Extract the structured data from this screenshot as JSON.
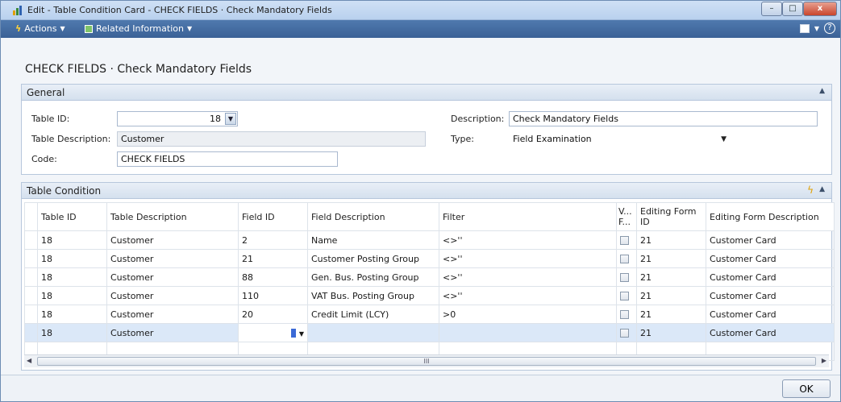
{
  "window": {
    "title": "Edit - Table Condition Card - CHECK FIELDS · Check Mandatory Fields",
    "min": "–",
    "max": "□",
    "close": "x"
  },
  "toolbar": {
    "actions_label": "Actions",
    "related_label": "Related Information",
    "caret": "▼",
    "help_icon": "?"
  },
  "page_title": "CHECK FIELDS · Check Mandatory Fields",
  "general": {
    "header": "General",
    "table_id_label": "Table ID:",
    "table_id_value": "18",
    "table_desc_label": "Table Description:",
    "table_desc_value": "Customer",
    "code_label": "Code:",
    "code_value": "CHECK FIELDS",
    "description_label": "Description:",
    "description_value": "Check Mandatory Fields",
    "type_label": "Type:",
    "type_value": "Field Examination"
  },
  "condition": {
    "header": "Table Condition",
    "columns": {
      "table_id": "Table ID",
      "table_desc": "Table Description",
      "field_id": "Field ID",
      "field_desc": "Field Description",
      "filter": "Filter",
      "vf_1": "V...",
      "vf_2": "F...",
      "edit_form_1": "Editing Form",
      "edit_form_2": "ID",
      "edit_form_desc": "Editing Form Description"
    },
    "rows": [
      {
        "table_id": "18",
        "table_desc": "Customer",
        "field_id": "2",
        "field_desc": "Name",
        "filter": "<>''",
        "form_id": "21",
        "form_desc": "Customer Card"
      },
      {
        "table_id": "18",
        "table_desc": "Customer",
        "field_id": "21",
        "field_desc": "Customer Posting Group",
        "filter": "<>''",
        "form_id": "21",
        "form_desc": "Customer Card"
      },
      {
        "table_id": "18",
        "table_desc": "Customer",
        "field_id": "88",
        "field_desc": "Gen. Bus. Posting Group",
        "filter": "<>''",
        "form_id": "21",
        "form_desc": "Customer Card"
      },
      {
        "table_id": "18",
        "table_desc": "Customer",
        "field_id": "110",
        "field_desc": "VAT Bus. Posting Group",
        "filter": "<>''",
        "form_id": "21",
        "form_desc": "Customer Card"
      },
      {
        "table_id": "18",
        "table_desc": "Customer",
        "field_id": "20",
        "field_desc": "Credit Limit (LCY)",
        "filter": ">0",
        "form_id": "21",
        "form_desc": "Customer Card"
      },
      {
        "table_id": "18",
        "table_desc": "Customer",
        "field_id": "",
        "field_desc": "",
        "filter": "",
        "form_id": "21",
        "form_desc": "Customer Card"
      }
    ],
    "scroll_thumb": "III"
  },
  "footer": {
    "ok_label": "OK"
  }
}
